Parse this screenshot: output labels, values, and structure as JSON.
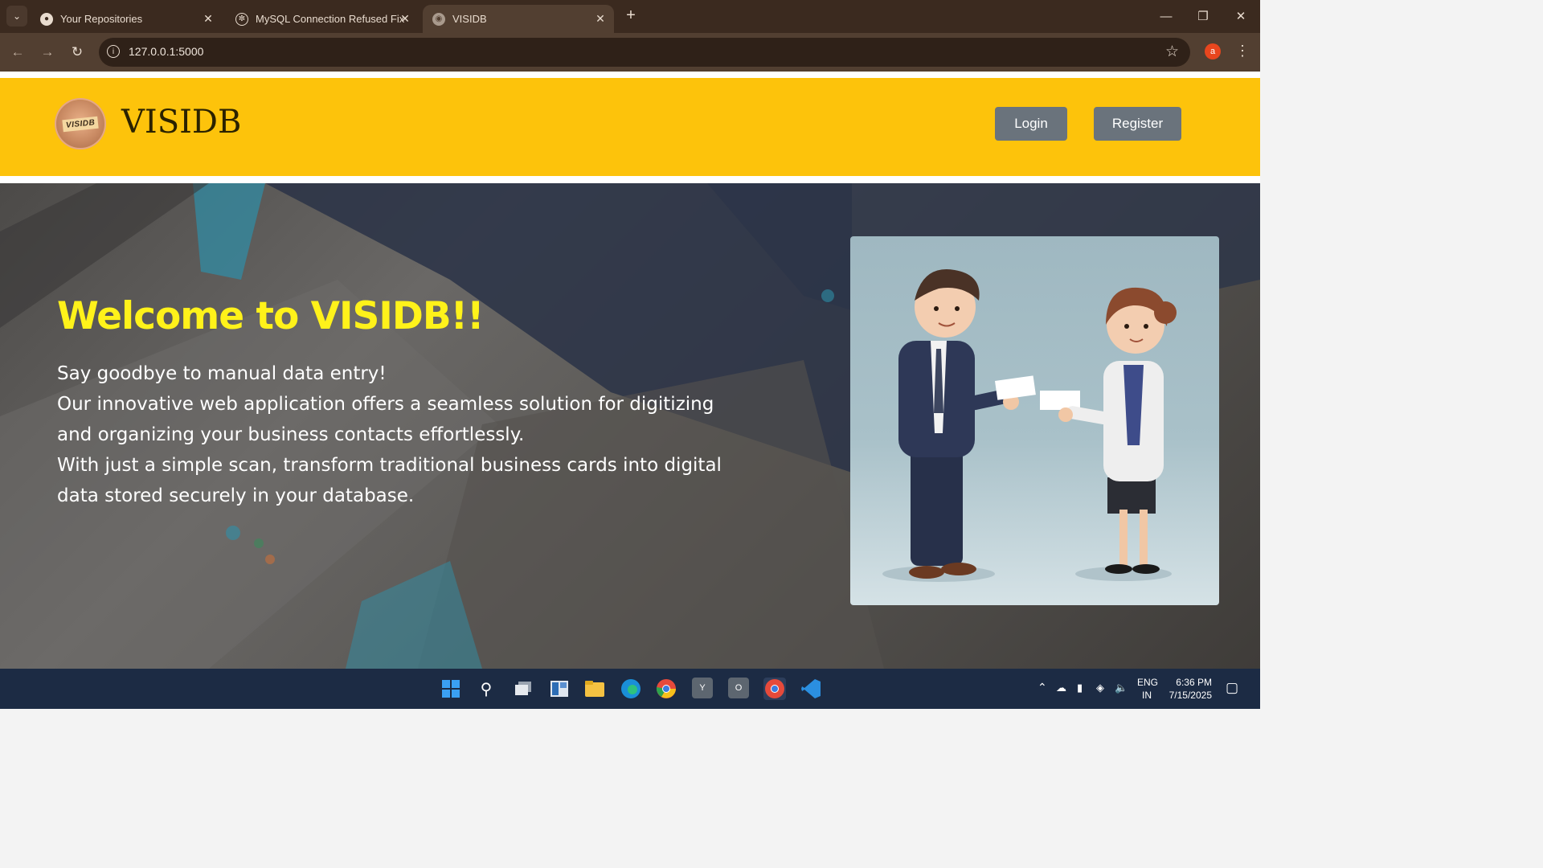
{
  "browser": {
    "tabs": [
      {
        "title": "Your Repositories",
        "icon": "github-icon"
      },
      {
        "title": "MySQL Connection Refused Fix",
        "icon": "chatgpt-icon"
      },
      {
        "title": "VISIDB",
        "icon": "globe-icon",
        "active": true
      }
    ],
    "url": "127.0.0.1:5000",
    "profile_initial": "a"
  },
  "site": {
    "logo_text": "VISIDB",
    "brand": "VISIDB",
    "login_label": "Login",
    "register_label": "Register",
    "header_color": "#fdc30b"
  },
  "hero": {
    "title": "Welcome to VISIDB!!",
    "lines": [
      "Say goodbye to manual data entry!",
      "Our innovative web application offers a seamless solution for digitizing",
      "and organizing your business contacts effortlessly.",
      "With just a simple scan, transform traditional business cards into digital",
      "data stored securely in your database."
    ],
    "title_color": "#fff21a"
  },
  "taskbar": {
    "lang_top": "ENG",
    "lang_bottom": "IN",
    "time": "6:36 PM",
    "date": "7/15/2025"
  }
}
